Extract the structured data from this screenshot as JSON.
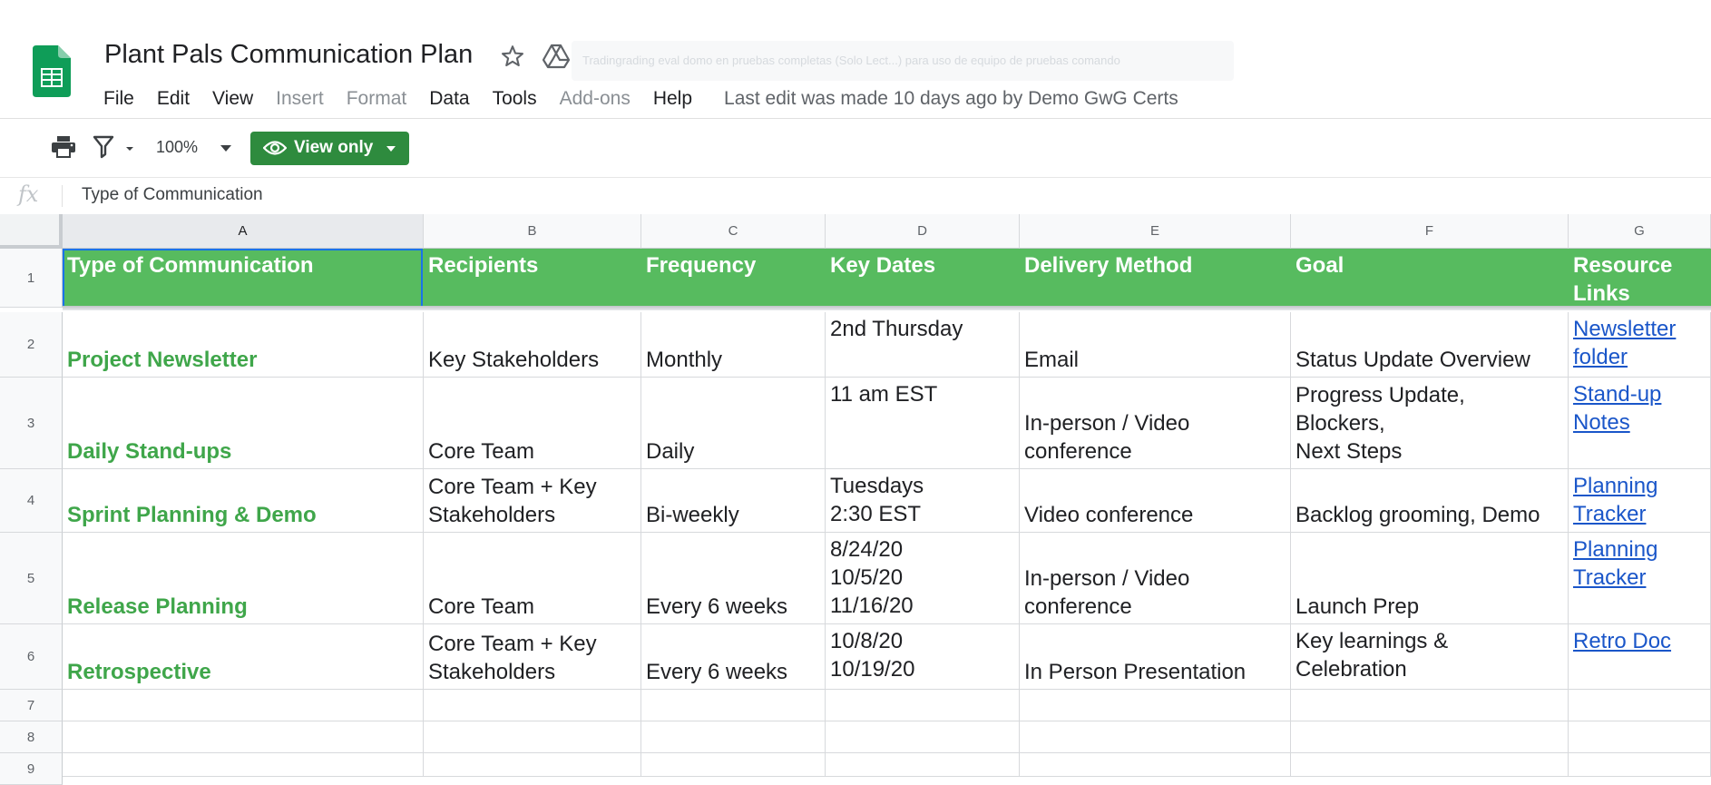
{
  "app": {
    "title": "Plant Pals Communication Plan",
    "banner_text": "Tradingrading eval domo en pruebas completas (Solo Lect...) para uso de equipo de pruebas comando",
    "colors": {
      "accent_green": "#57bb5f",
      "button_green": "#2e8b3e",
      "link_blue": "#1a56c9",
      "name_green": "#3fa64a"
    }
  },
  "menu": {
    "items": [
      "File",
      "Edit",
      "View",
      "Insert",
      "Format",
      "Data",
      "Tools",
      "Add-ons",
      "Help"
    ],
    "disabled": [
      "Insert",
      "Format",
      "Add-ons"
    ],
    "last_edit": "Last edit was made 10 days ago by Demo GwG Certs"
  },
  "toolbar": {
    "zoom": "100%",
    "view_only_label": "View only",
    "icons": [
      "print-icon",
      "filter-icon",
      "eye-icon"
    ]
  },
  "formula_bar": {
    "fx_label": "fx",
    "content": "Type of Communication"
  },
  "sheet": {
    "columns": [
      "A",
      "B",
      "C",
      "D",
      "E",
      "F",
      "G"
    ],
    "rows": [
      "1",
      "2",
      "3",
      "4",
      "5",
      "6",
      "7",
      "8",
      "9"
    ],
    "headers": [
      "Type of Communication",
      "Recipients",
      "Frequency",
      "Key Dates",
      "Delivery Method",
      "Goal",
      "Resource\nLinks"
    ],
    "data": [
      [
        "Project Newsletter",
        "Key Stakeholders",
        "Monthly",
        "2nd Thursday",
        "Email",
        "Status Update Overview",
        "Newsletter\nfolder"
      ],
      [
        "Daily Stand-ups",
        "Core Team",
        "Daily",
        "11 am EST",
        "In-person / Video\nconference",
        "Progress Update,\nBlockers,\nNext Steps",
        "Stand-up\nNotes"
      ],
      [
        "Sprint Planning & Demo",
        "Core Team + Key\nStakeholders",
        "Bi-weekly",
        "Tuesdays\n2:30 EST",
        "Video conference",
        "Backlog grooming, Demo",
        "Planning\nTracker"
      ],
      [
        "Release Planning",
        "Core Team",
        "Every 6 weeks",
        "8/24/20\n10/5/20\n11/16/20",
        "In-person / Video\nconference",
        "Launch Prep",
        "Planning\nTracker"
      ],
      [
        "Retrospective",
        "Core Team + Key\nStakeholders",
        "Every 6 weeks",
        "10/8/20\n10/19/20",
        "In Person Presentation",
        "Key learnings &\nCelebration",
        "Retro Doc"
      ]
    ]
  }
}
